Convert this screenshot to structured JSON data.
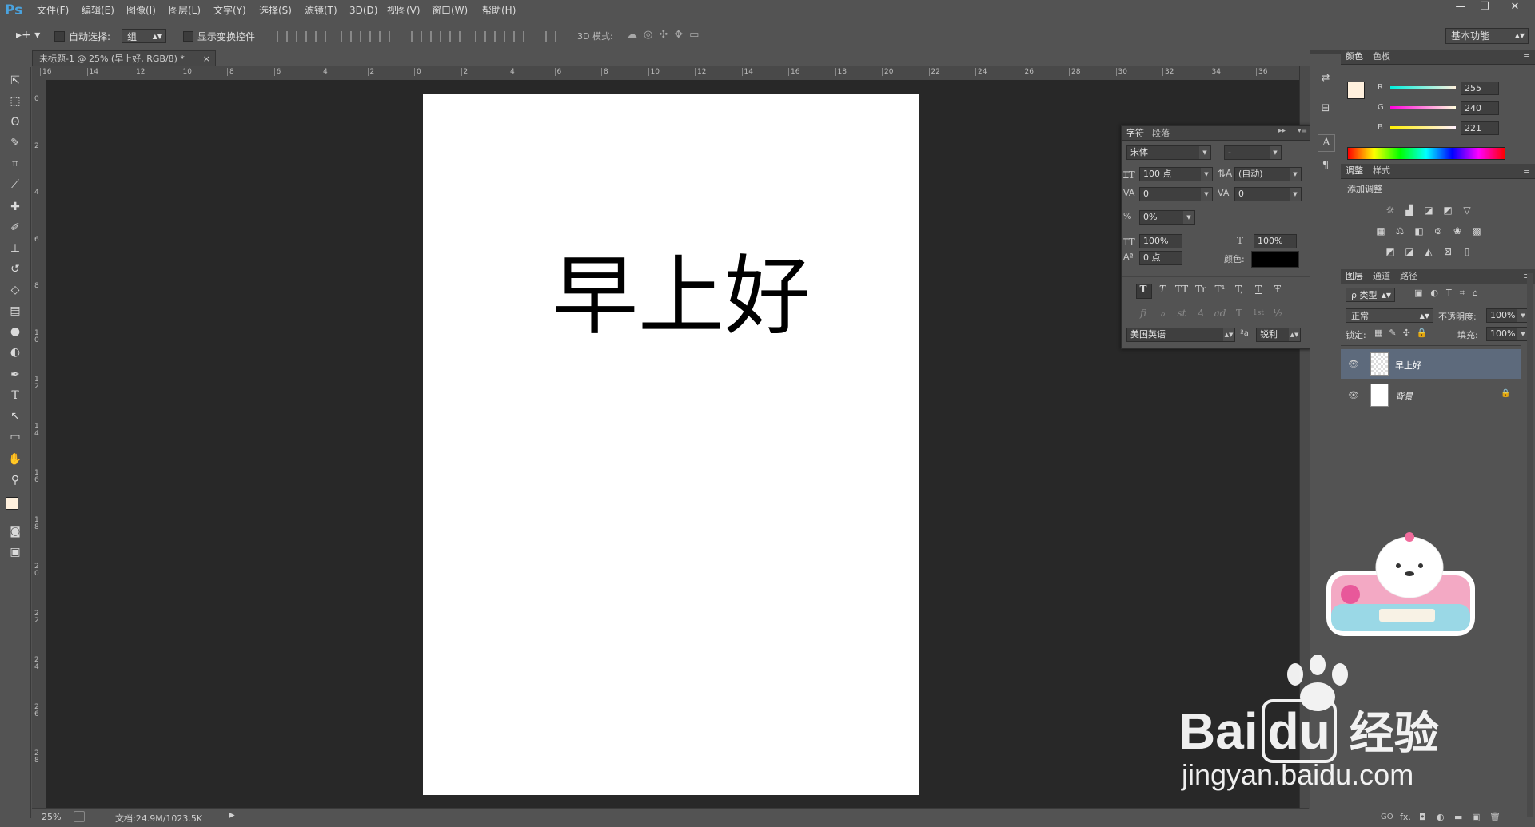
{
  "app": {
    "logo": "Ps"
  },
  "menu": [
    "文件(F)",
    "编辑(E)",
    "图像(I)",
    "图层(L)",
    "文字(Y)",
    "选择(S)",
    "滤镜(T)",
    "3D(D)",
    "视图(V)",
    "窗口(W)",
    "帮助(H)"
  ],
  "window_controls": {
    "minimize": "—",
    "restore": "❐",
    "close": "✕"
  },
  "options": {
    "auto_select_label": "自动选择:",
    "auto_select_value": "组",
    "show_transform_label": "显示变换控件",
    "mode3d_label": "3D 模式:",
    "workspace_value": "基本功能"
  },
  "document": {
    "tab_title": "未标题-1 @ 25% (早上好, RGB/8) *",
    "tab_close": "×",
    "text": "早上好"
  },
  "ruler_top": [
    "16",
    "14",
    "12",
    "10",
    "8",
    "6",
    "4",
    "2",
    "0",
    "2",
    "4",
    "6",
    "8",
    "10",
    "12",
    "14",
    "16",
    "18",
    "20",
    "22",
    "24",
    "26",
    "28",
    "30",
    "32",
    "34",
    "36"
  ],
  "ruler_left": [
    "0",
    "2",
    "4",
    "6",
    "8",
    "1 0",
    "1 2",
    "1 4",
    "1 6",
    "1 8",
    "2 0",
    "2 2",
    "2 4",
    "2 6",
    "2 8"
  ],
  "status": {
    "zoom": "25%",
    "doc_info": "文档:24.9M/1023.5K"
  },
  "character_panel": {
    "tabs": [
      "字符",
      "段落"
    ],
    "font_family": "宋体",
    "font_style": "-",
    "font_size": "100 点",
    "leading": "(自动)",
    "kerning": "0",
    "tracking": "0",
    "tsume": "0%",
    "vscale": "100%",
    "hscale": "100%",
    "baseline": "0 点",
    "color_label": "颜色:",
    "text_color": "#000000",
    "style_buttons": [
      "T",
      "T",
      "TT",
      "Tr",
      "T¹",
      "T,",
      "T",
      "Ŧ"
    ],
    "opentype_buttons": [
      "fi",
      "ℴ",
      "st",
      "A",
      "ad",
      "T",
      "1st",
      "½"
    ],
    "language": "美国英语",
    "aa_icon": "ªa",
    "antialias": "锐利"
  },
  "color_panel": {
    "tabs": [
      "颜色",
      "色板"
    ],
    "foreground": "#fff0dd",
    "r_label": "R",
    "r": "255",
    "g_label": "G",
    "g": "240",
    "b_label": "B",
    "b": "221"
  },
  "adjust_panel": {
    "tabs": [
      "调整",
      "样式"
    ],
    "title": "添加调整"
  },
  "layers_panel": {
    "tabs": [
      "图层",
      "通道",
      "路径"
    ],
    "filter_kind": "ρ 类型",
    "blend_mode": "正常",
    "opacity_label": "不透明度:",
    "opacity": "100%",
    "lock_label": "锁定:",
    "fill_label": "填充:",
    "fill": "100%",
    "layers": [
      {
        "name": "早上好",
        "selected": true
      },
      {
        "name": "背景",
        "locked": true
      }
    ],
    "footer_icons": [
      "GO",
      "fx.",
      "◘",
      "◐",
      "▬",
      "▣",
      "🗑"
    ]
  },
  "watermark": {
    "brand": "Bai",
    "brand2": "du",
    "cn": "经验",
    "url": "jingyan.baidu.com"
  }
}
